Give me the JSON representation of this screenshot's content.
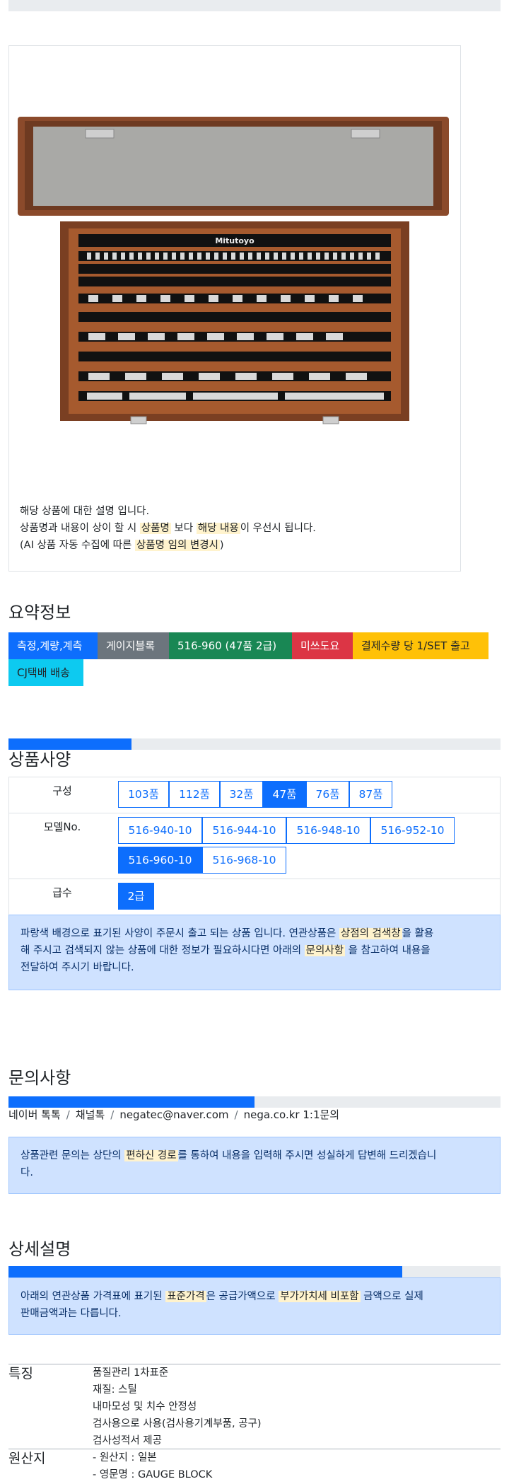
{
  "product_image": {
    "brand": "Mitutoyo"
  },
  "description": {
    "line1": "해당 상품에 대한 설명 입니다.",
    "line2_a": "상품명과 내용이 상이 할 시 ",
    "line2_mark1": "상품명",
    "line2_b": " 보다 ",
    "line2_mark2": "해당 내용",
    "line2_c": "이 우선시 됩니다.",
    "line3_a": "(AI 상품 자동 수집에 따른 ",
    "line3_mark": "상품명 임의 변경시",
    "line3_b": ")"
  },
  "summary": {
    "title": "요약정보",
    "badges": [
      {
        "label": "측정,계량,계측",
        "color": "#0d6efd"
      },
      {
        "label": "게이지블록",
        "color": "#6c757d"
      },
      {
        "label": "516-960 (47품 2급)",
        "color": "#198754"
      },
      {
        "label": "미쓰도요",
        "color": "#dc3545"
      },
      {
        "label": "결제수량 당 1/SET 출고",
        "color": "#ffc107"
      },
      {
        "label": "CJ택배 배송",
        "color": "#0dcaf0"
      }
    ]
  },
  "spec": {
    "progress_percent": 25,
    "title": "상품사양",
    "rows": [
      {
        "label": "구성",
        "options": [
          "103품",
          "112품",
          "32품",
          "47품",
          "76품",
          "87품"
        ],
        "selected": "47품"
      },
      {
        "label": "모델No.",
        "options": [
          "516-940-10",
          "516-944-10",
          "516-948-10",
          "516-952-10",
          "516-960-10",
          "516-968-10"
        ],
        "selected": "516-960-10"
      },
      {
        "label": "급수",
        "options": [
          "2급"
        ],
        "selected": "2급"
      }
    ],
    "notice_a": "파랑색 배경으로 표기된 사양이 주문시 출고 되는 상품 입니다. 연관상품은 ",
    "notice_mark1": "상점의 검색창",
    "notice_b": "을 활용",
    "notice_c": "해 주시고 검색되지 않는 상품에 대한 정보가 필요하시다면 아래의 ",
    "notice_mark2": "문의사항",
    "notice_d": " 을 참고하여 내용을",
    "notice_e": "전달하여 주시기 바랍니다."
  },
  "inquiry": {
    "title": "문의사항",
    "progress_percent": 50,
    "links": [
      "네이버 톡톡",
      "채널톡",
      "negatec@naver.com",
      "nega.co.kr 1:1문의"
    ],
    "notice_a": "상품관련 문의는 상단의 ",
    "notice_mark": "편하신 경로",
    "notice_b": "를 통하여 내용을 입력해 주시면 성실하게 답변해 드리겠습니",
    "notice_c": "다."
  },
  "detail": {
    "title": "상세설명",
    "progress_percent": 80,
    "notice_a": "아래의 연관상품 가격표에 표기된 ",
    "notice_mark1": "표준가격",
    "notice_b": "은 공급가액으로 ",
    "notice_mark2": "부가가치세 비포함",
    "notice_c": " 금액으로 실제",
    "notice_d": "판매금액과는 다릅니다.",
    "features": {
      "label": "특징",
      "items": [
        "품질관리 1차표준",
        "재질: 스틸",
        "내마모성 및 치수 안정성",
        "검사용으로 사용(검사용기계부품, 공구)",
        "검사성적서 제공"
      ]
    },
    "origin": {
      "label": "원산지",
      "items": [
        "- 원산지 : 일본",
        "- 영문명 : GAUGE BLOCK"
      ]
    }
  }
}
